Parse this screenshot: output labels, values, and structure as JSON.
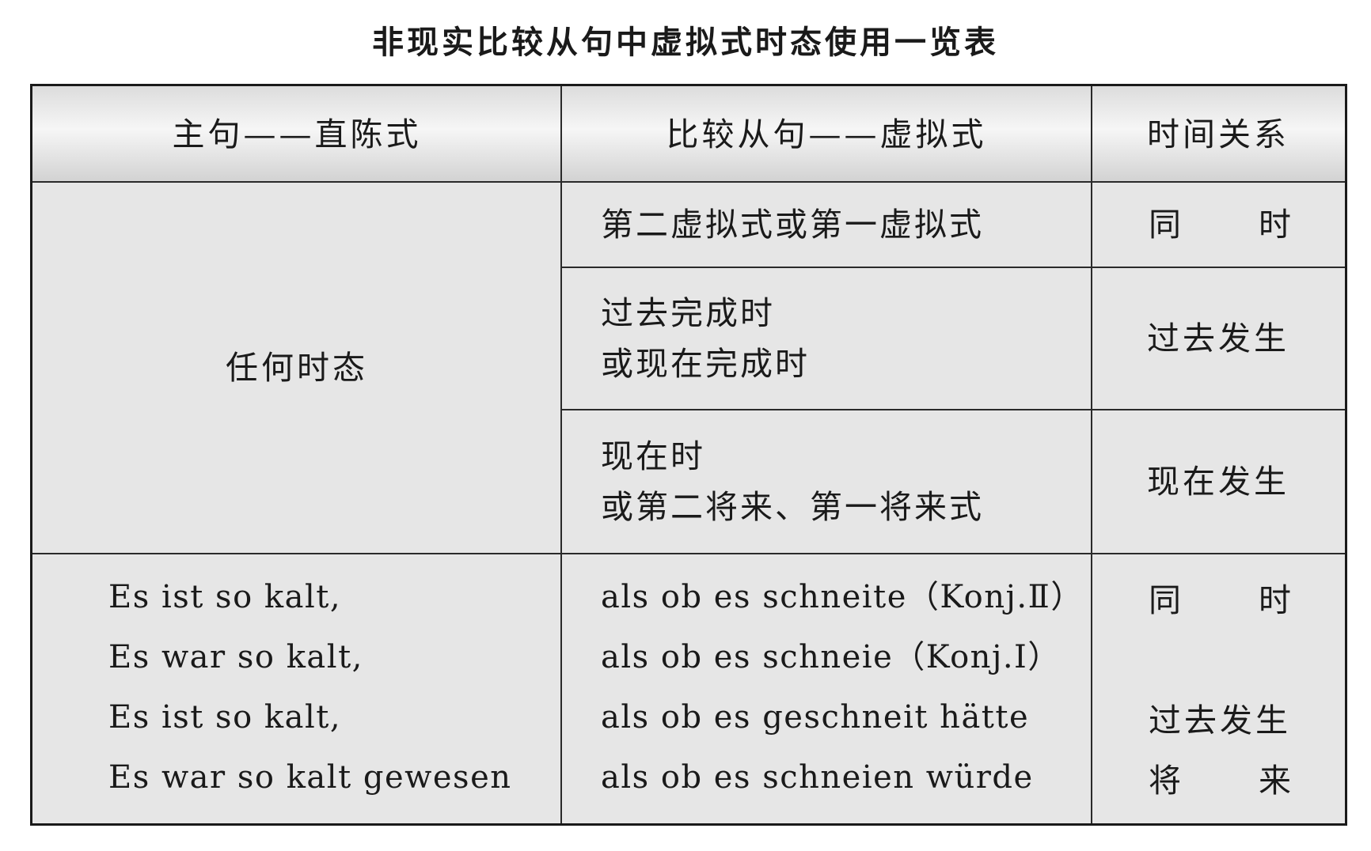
{
  "title": "非现实比较从句中虚拟式时态使用一览表",
  "headers": [
    "主句——直陈式",
    "比较从句——虚拟式",
    "时间关系"
  ],
  "main_tense": "任何时态",
  "rows": [
    {
      "clause_lines": [
        "第二虚拟式或第一虚拟式"
      ],
      "time_chars": [
        "同",
        "时"
      ]
    },
    {
      "clause_lines": [
        "过去完成时",
        "或现在完成时"
      ],
      "time": "过去发生"
    },
    {
      "clause_lines": [
        "现在时",
        "或第二将来、第一将来式"
      ],
      "time": "现在发生"
    }
  ],
  "examples": {
    "main": [
      "Es ist so kalt,",
      "Es war so kalt,",
      "Es ist so kalt,",
      "Es war so kalt gewesen"
    ],
    "clause": [
      "als ob es schneite（Konj.Ⅱ）",
      "als ob es schneie（Konj.Ⅰ）",
      "als ob es geschneit hätte",
      "als ob es schneien würde"
    ],
    "time_simultaneous": [
      "同",
      "时"
    ],
    "time_past": "过去发生",
    "time_future": [
      "将",
      "来"
    ]
  }
}
